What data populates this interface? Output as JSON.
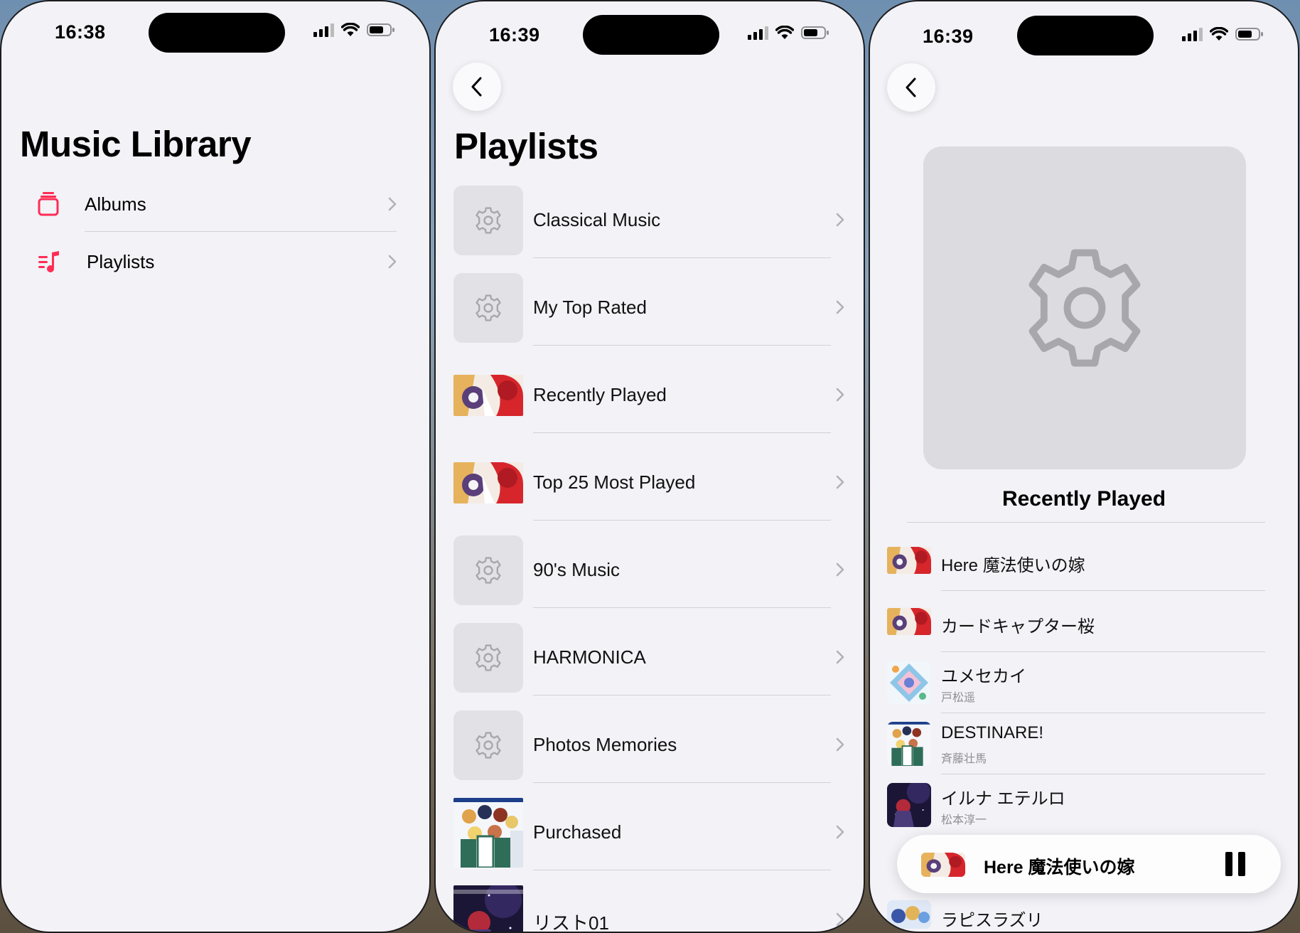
{
  "colors": {
    "accent": "#ff2d55",
    "background": "#f2f2f7",
    "separator": "#d1d1d6",
    "placeholder": "#e2e2e6",
    "chevron": "#b0b0b5",
    "secondary_text": "#8e8e93"
  },
  "screen1": {
    "time": "16:38",
    "title": "Music Library",
    "rows": [
      {
        "label": "Albums",
        "icon": "album-stack-icon"
      },
      {
        "label": "Playlists",
        "icon": "playlist-icon"
      }
    ]
  },
  "screen2": {
    "time": "16:39",
    "title": "Playlists",
    "playlists": [
      {
        "label": "Classical Music",
        "artwork": "gear-placeholder-icon"
      },
      {
        "label": "My Top Rated",
        "artwork": "gear-placeholder-icon"
      },
      {
        "label": "Recently Played",
        "artwork": "album-art-red"
      },
      {
        "label": "Top 25 Most Played",
        "artwork": "album-art-red"
      },
      {
        "label": "90's Music",
        "artwork": "gear-placeholder-icon"
      },
      {
        "label": "HARMONICA",
        "artwork": "gear-placeholder-icon"
      },
      {
        "label": "Photos Memories",
        "artwork": "gear-placeholder-icon"
      },
      {
        "label": "Purchased",
        "artwork": "album-art-group"
      },
      {
        "label": "リスト01",
        "artwork": "album-art-space"
      }
    ]
  },
  "screen3": {
    "time": "16:39",
    "playlist_title": "Recently Played",
    "tracks": [
      {
        "title": "Here 魔法使いの嫁",
        "artist": "",
        "artwork": "album-art-red"
      },
      {
        "title": "カードキャプター桜",
        "artist": "",
        "artwork": "album-art-red"
      },
      {
        "title": "ユメセカイ",
        "artist": "戸松遥",
        "artwork": "album-art-diamond"
      },
      {
        "title": "DESTINARE!",
        "artist": "斉藤壮馬",
        "artwork": "album-art-group"
      },
      {
        "title": "イルナ エテルロ",
        "artist": "松本淳一",
        "artwork": "album-art-space"
      },
      {
        "title": "ラピスラズリ",
        "artist": "",
        "artwork": "album-art-blue"
      }
    ],
    "mini_player": {
      "title": "Here 魔法使いの嫁",
      "control": "pause-icon"
    }
  }
}
